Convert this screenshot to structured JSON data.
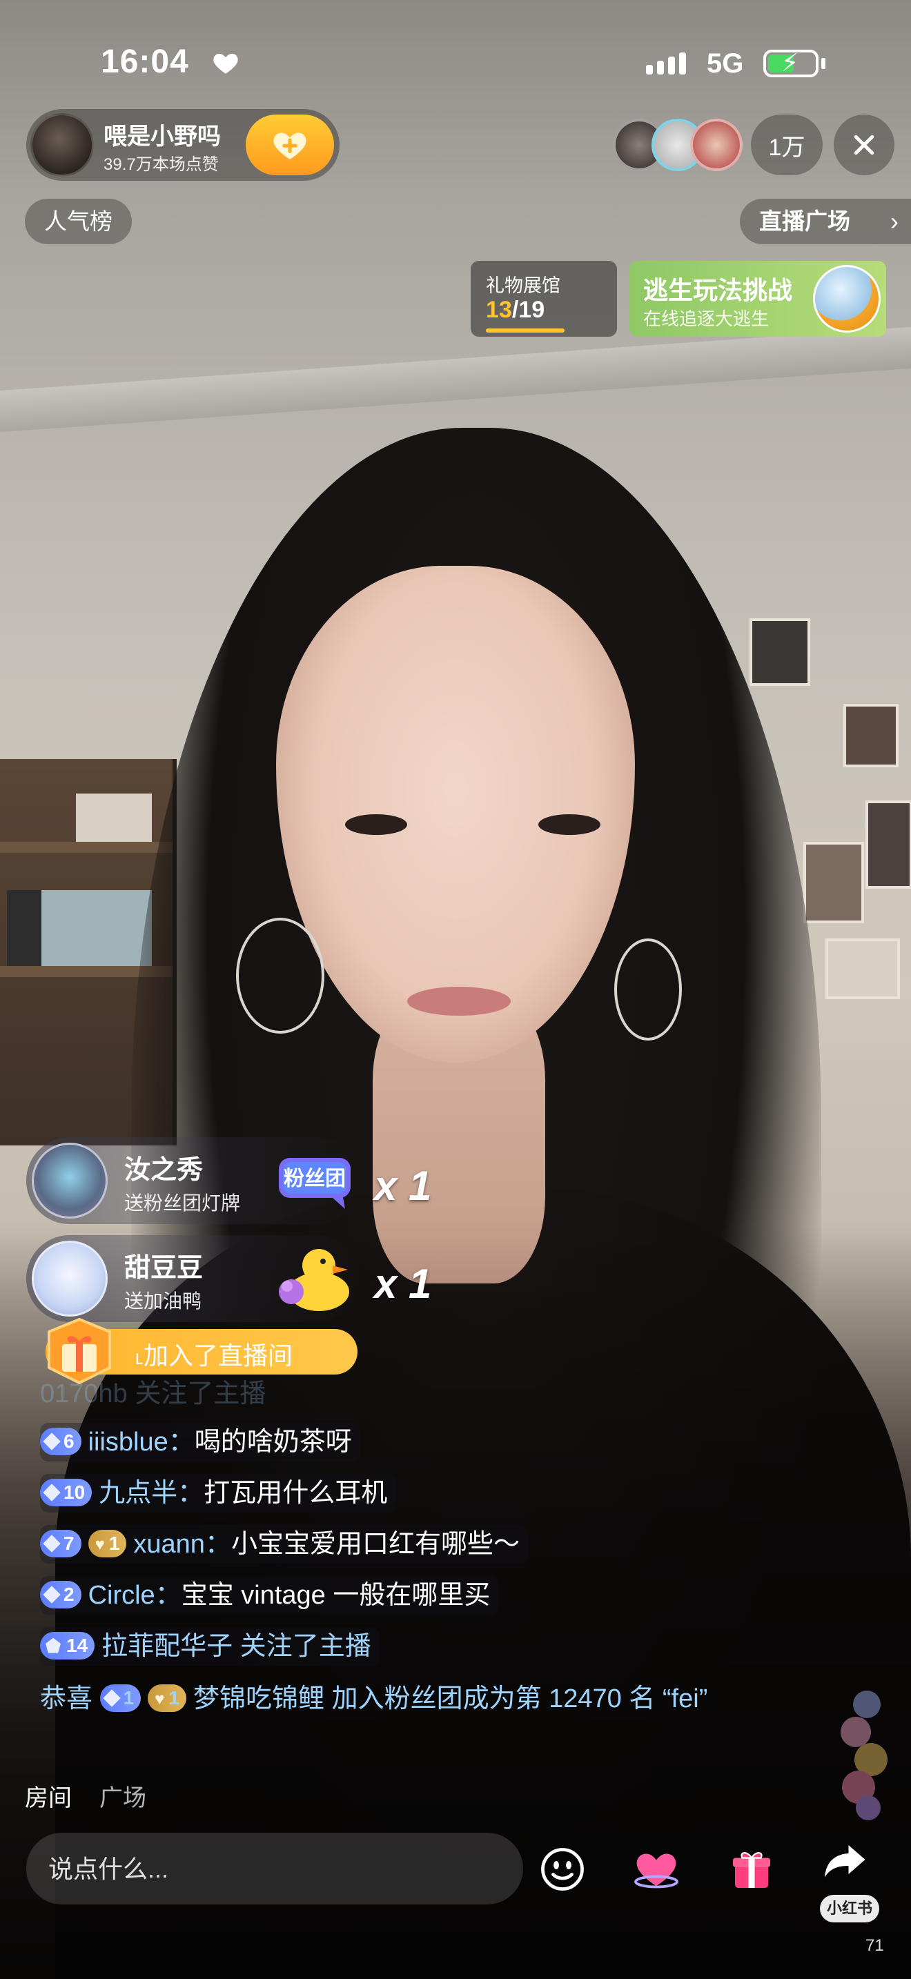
{
  "status_bar": {
    "time": "16:04",
    "network": "5G",
    "icons": [
      "heart-icon",
      "signal-icon",
      "battery-charging-icon"
    ],
    "colors": {
      "battery_fill": "#4bd964"
    }
  },
  "host": {
    "name": "喂是小野吗",
    "likes": "39.7万本场点赞",
    "follow_icon": "heart-plus-icon",
    "viewer_count": "1万",
    "colors": {
      "follow_button": "#ff9a1f"
    }
  },
  "top_row": {
    "rank_label": "人气榜",
    "plaza_label": "直播广场",
    "plaza_chevron": "›"
  },
  "gift_hall": {
    "title": "礼物展馆",
    "current": "13",
    "separator": "/",
    "total": "19",
    "progress_fraction": 0.68
  },
  "escape_banner": {
    "title": "逃生玩法挑战",
    "subtitle": "在线追逐大逃生",
    "colors": {
      "background": "#9fd06c"
    }
  },
  "gift_toasts": [
    {
      "name": "汝之秀",
      "desc": "送粉丝团灯牌",
      "gift_label": "粉丝团",
      "count": "x 1",
      "gift_icon": "fan-club-light-icon"
    },
    {
      "name": "甜豆豆",
      "desc": "送加油鸭",
      "gift_label": "",
      "count": "x 1",
      "gift_icon": "duck-icon"
    }
  ],
  "join_banner": {
    "text": "˪加入了直播间",
    "icon": "gift-box-icon"
  },
  "chat": {
    "faded_line": "0170hb 关注了主播",
    "lines": [
      {
        "level": "6",
        "fan": "",
        "user": "iiisblue",
        "sep": "：",
        "text": "喝的啥奶茶呀"
      },
      {
        "level": "10",
        "fan": "",
        "user": "九点半",
        "sep": "：",
        "text": "打瓦用什么耳机"
      },
      {
        "level": "7",
        "fan": "1",
        "user": "xuann",
        "sep": "：",
        "text": "小宝宝爱用口红有哪些～"
      },
      {
        "level": "2",
        "fan": "",
        "user": "Circle",
        "sep": "：",
        "text": "宝宝 vintage 一般在哪里买"
      },
      {
        "level": "14",
        "fan": "",
        "user": "拉菲配华子",
        "sep": " ",
        "text": "关注了主播"
      }
    ],
    "notice": {
      "prefix": "恭喜",
      "level": "1",
      "fan": "1",
      "user": "梦锦吃锦鲤",
      "text": "加入粉丝团成为第 12470 名 “fei”"
    },
    "colors": {
      "username": "#9fd4ff",
      "level_badge": "#5b7cff",
      "fan_badge": "#d4a54b"
    }
  },
  "tabs": [
    {
      "label": "房间",
      "active": true
    },
    {
      "label": "广场",
      "active": false
    }
  ],
  "bottom_bar": {
    "input_placeholder": "说点什么...",
    "icons": [
      "emoji-icon",
      "like-heart-icon",
      "gift-icon",
      "share-icon"
    ],
    "share_label": "小红书",
    "page_number": "71",
    "colors": {
      "gift": "#ff3d7f",
      "heart": "#ff5aa0"
    }
  }
}
